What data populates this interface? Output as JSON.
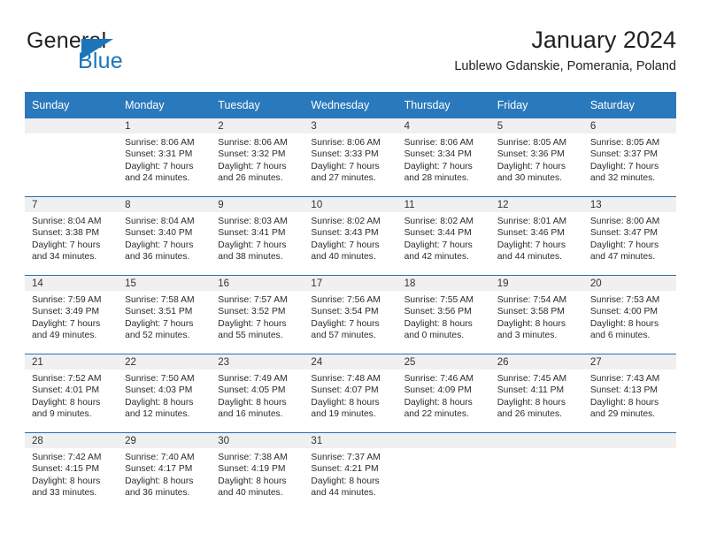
{
  "brand": {
    "word_one": "General",
    "word_two": "Blue",
    "accent_color": "#1b75bb",
    "dark_color": "#231f20"
  },
  "header": {
    "title": "January 2024",
    "subtitle": "Lublewo Gdanskie, Pomerania, Poland",
    "header_bg_color": "#2a79bd",
    "row_divider_color": "#2a6da8",
    "daynum_band_color": "#f0f0f0"
  },
  "weekday_headers": [
    "Sunday",
    "Monday",
    "Tuesday",
    "Wednesday",
    "Thursday",
    "Friday",
    "Saturday"
  ],
  "weeks": [
    [
      {
        "day": "",
        "lines": []
      },
      {
        "day": "1",
        "lines": [
          "Sunrise: 8:06 AM",
          "Sunset: 3:31 PM",
          "Daylight: 7 hours",
          "and 24 minutes."
        ]
      },
      {
        "day": "2",
        "lines": [
          "Sunrise: 8:06 AM",
          "Sunset: 3:32 PM",
          "Daylight: 7 hours",
          "and 26 minutes."
        ]
      },
      {
        "day": "3",
        "lines": [
          "Sunrise: 8:06 AM",
          "Sunset: 3:33 PM",
          "Daylight: 7 hours",
          "and 27 minutes."
        ]
      },
      {
        "day": "4",
        "lines": [
          "Sunrise: 8:06 AM",
          "Sunset: 3:34 PM",
          "Daylight: 7 hours",
          "and 28 minutes."
        ]
      },
      {
        "day": "5",
        "lines": [
          "Sunrise: 8:05 AM",
          "Sunset: 3:36 PM",
          "Daylight: 7 hours",
          "and 30 minutes."
        ]
      },
      {
        "day": "6",
        "lines": [
          "Sunrise: 8:05 AM",
          "Sunset: 3:37 PM",
          "Daylight: 7 hours",
          "and 32 minutes."
        ]
      }
    ],
    [
      {
        "day": "7",
        "lines": [
          "Sunrise: 8:04 AM",
          "Sunset: 3:38 PM",
          "Daylight: 7 hours",
          "and 34 minutes."
        ]
      },
      {
        "day": "8",
        "lines": [
          "Sunrise: 8:04 AM",
          "Sunset: 3:40 PM",
          "Daylight: 7 hours",
          "and 36 minutes."
        ]
      },
      {
        "day": "9",
        "lines": [
          "Sunrise: 8:03 AM",
          "Sunset: 3:41 PM",
          "Daylight: 7 hours",
          "and 38 minutes."
        ]
      },
      {
        "day": "10",
        "lines": [
          "Sunrise: 8:02 AM",
          "Sunset: 3:43 PM",
          "Daylight: 7 hours",
          "and 40 minutes."
        ]
      },
      {
        "day": "11",
        "lines": [
          "Sunrise: 8:02 AM",
          "Sunset: 3:44 PM",
          "Daylight: 7 hours",
          "and 42 minutes."
        ]
      },
      {
        "day": "12",
        "lines": [
          "Sunrise: 8:01 AM",
          "Sunset: 3:46 PM",
          "Daylight: 7 hours",
          "and 44 minutes."
        ]
      },
      {
        "day": "13",
        "lines": [
          "Sunrise: 8:00 AM",
          "Sunset: 3:47 PM",
          "Daylight: 7 hours",
          "and 47 minutes."
        ]
      }
    ],
    [
      {
        "day": "14",
        "lines": [
          "Sunrise: 7:59 AM",
          "Sunset: 3:49 PM",
          "Daylight: 7 hours",
          "and 49 minutes."
        ]
      },
      {
        "day": "15",
        "lines": [
          "Sunrise: 7:58 AM",
          "Sunset: 3:51 PM",
          "Daylight: 7 hours",
          "and 52 minutes."
        ]
      },
      {
        "day": "16",
        "lines": [
          "Sunrise: 7:57 AM",
          "Sunset: 3:52 PM",
          "Daylight: 7 hours",
          "and 55 minutes."
        ]
      },
      {
        "day": "17",
        "lines": [
          "Sunrise: 7:56 AM",
          "Sunset: 3:54 PM",
          "Daylight: 7 hours",
          "and 57 minutes."
        ]
      },
      {
        "day": "18",
        "lines": [
          "Sunrise: 7:55 AM",
          "Sunset: 3:56 PM",
          "Daylight: 8 hours",
          "and 0 minutes."
        ]
      },
      {
        "day": "19",
        "lines": [
          "Sunrise: 7:54 AM",
          "Sunset: 3:58 PM",
          "Daylight: 8 hours",
          "and 3 minutes."
        ]
      },
      {
        "day": "20",
        "lines": [
          "Sunrise: 7:53 AM",
          "Sunset: 4:00 PM",
          "Daylight: 8 hours",
          "and 6 minutes."
        ]
      }
    ],
    [
      {
        "day": "21",
        "lines": [
          "Sunrise: 7:52 AM",
          "Sunset: 4:01 PM",
          "Daylight: 8 hours",
          "and 9 minutes."
        ]
      },
      {
        "day": "22",
        "lines": [
          "Sunrise: 7:50 AM",
          "Sunset: 4:03 PM",
          "Daylight: 8 hours",
          "and 12 minutes."
        ]
      },
      {
        "day": "23",
        "lines": [
          "Sunrise: 7:49 AM",
          "Sunset: 4:05 PM",
          "Daylight: 8 hours",
          "and 16 minutes."
        ]
      },
      {
        "day": "24",
        "lines": [
          "Sunrise: 7:48 AM",
          "Sunset: 4:07 PM",
          "Daylight: 8 hours",
          "and 19 minutes."
        ]
      },
      {
        "day": "25",
        "lines": [
          "Sunrise: 7:46 AM",
          "Sunset: 4:09 PM",
          "Daylight: 8 hours",
          "and 22 minutes."
        ]
      },
      {
        "day": "26",
        "lines": [
          "Sunrise: 7:45 AM",
          "Sunset: 4:11 PM",
          "Daylight: 8 hours",
          "and 26 minutes."
        ]
      },
      {
        "day": "27",
        "lines": [
          "Sunrise: 7:43 AM",
          "Sunset: 4:13 PM",
          "Daylight: 8 hours",
          "and 29 minutes."
        ]
      }
    ],
    [
      {
        "day": "28",
        "lines": [
          "Sunrise: 7:42 AM",
          "Sunset: 4:15 PM",
          "Daylight: 8 hours",
          "and 33 minutes."
        ]
      },
      {
        "day": "29",
        "lines": [
          "Sunrise: 7:40 AM",
          "Sunset: 4:17 PM",
          "Daylight: 8 hours",
          "and 36 minutes."
        ]
      },
      {
        "day": "30",
        "lines": [
          "Sunrise: 7:38 AM",
          "Sunset: 4:19 PM",
          "Daylight: 8 hours",
          "and 40 minutes."
        ]
      },
      {
        "day": "31",
        "lines": [
          "Sunrise: 7:37 AM",
          "Sunset: 4:21 PM",
          "Daylight: 8 hours",
          "and 44 minutes."
        ]
      },
      {
        "day": "",
        "lines": []
      },
      {
        "day": "",
        "lines": []
      },
      {
        "day": "",
        "lines": []
      }
    ]
  ]
}
